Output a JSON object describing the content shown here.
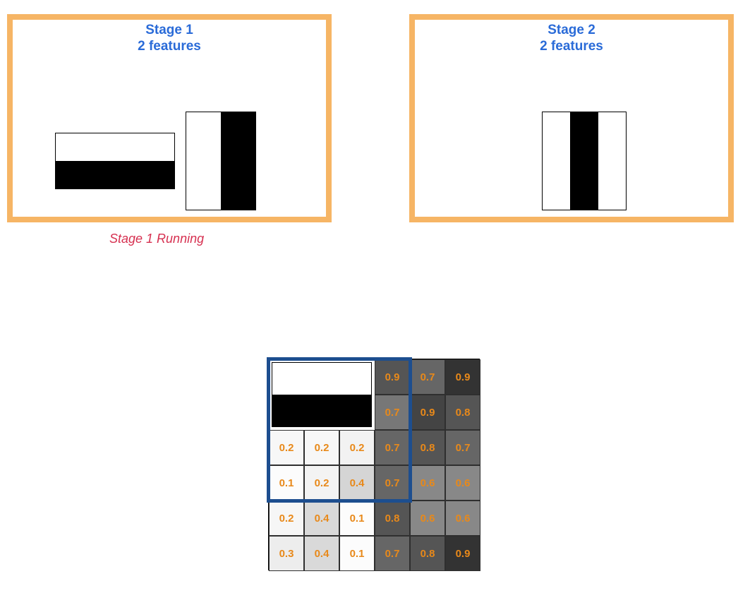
{
  "stages": {
    "stage1": {
      "title_line1": "Stage 1",
      "title_line2": "2 features",
      "status": "Stage 1 Running"
    },
    "stage2": {
      "title_line1": "Stage 2",
      "title_line2": "2 features"
    }
  },
  "chart_data": {
    "type": "heatmap",
    "title": "",
    "rows": 6,
    "cols": 6,
    "highlight_region": {
      "row_start": 0,
      "row_end": 3,
      "col_start": 0,
      "col_end": 3
    },
    "inset_feature": {
      "orientation": "horizontal",
      "rows_occupied": [
        0,
        1
      ],
      "cols_occupied": [
        0,
        1,
        2
      ]
    },
    "values": [
      [
        null,
        null,
        null,
        0.9,
        0.7,
        0.9
      ],
      [
        null,
        null,
        null,
        0.7,
        0.9,
        0.8
      ],
      [
        0.2,
        0.2,
        0.2,
        0.7,
        0.8,
        0.7
      ],
      [
        0.1,
        0.2,
        0.4,
        0.7,
        0.6,
        0.6
      ],
      [
        0.2,
        0.4,
        0.1,
        0.8,
        0.6,
        0.6
      ],
      [
        0.3,
        0.4,
        0.1,
        0.7,
        0.8,
        0.9
      ]
    ]
  },
  "cell_strings": {
    "r0c3": "0.9",
    "r0c4": "0.7",
    "r0c5": "0.9",
    "r1c3": "0.7",
    "r1c4": "0.9",
    "r1c5": "0.8",
    "r2c0": "0.2",
    "r2c1": "0.2",
    "r2c2": "0.2",
    "r2c3": "0.7",
    "r2c4": "0.8",
    "r2c5": "0.7",
    "r3c0": "0.1",
    "r3c1": "0.2",
    "r3c2": "0.4",
    "r3c3": "0.7",
    "r3c4": "0.6",
    "r3c5": "0.6",
    "r4c0": "0.2",
    "r4c1": "0.4",
    "r4c2": "0.1",
    "r4c3": "0.8",
    "r4c4": "0.6",
    "r4c5": "0.6",
    "r5c0": "0.3",
    "r5c1": "0.4",
    "r5c2": "0.1",
    "r5c3": "0.7",
    "r5c4": "0.8",
    "r5c5": "0.9"
  }
}
